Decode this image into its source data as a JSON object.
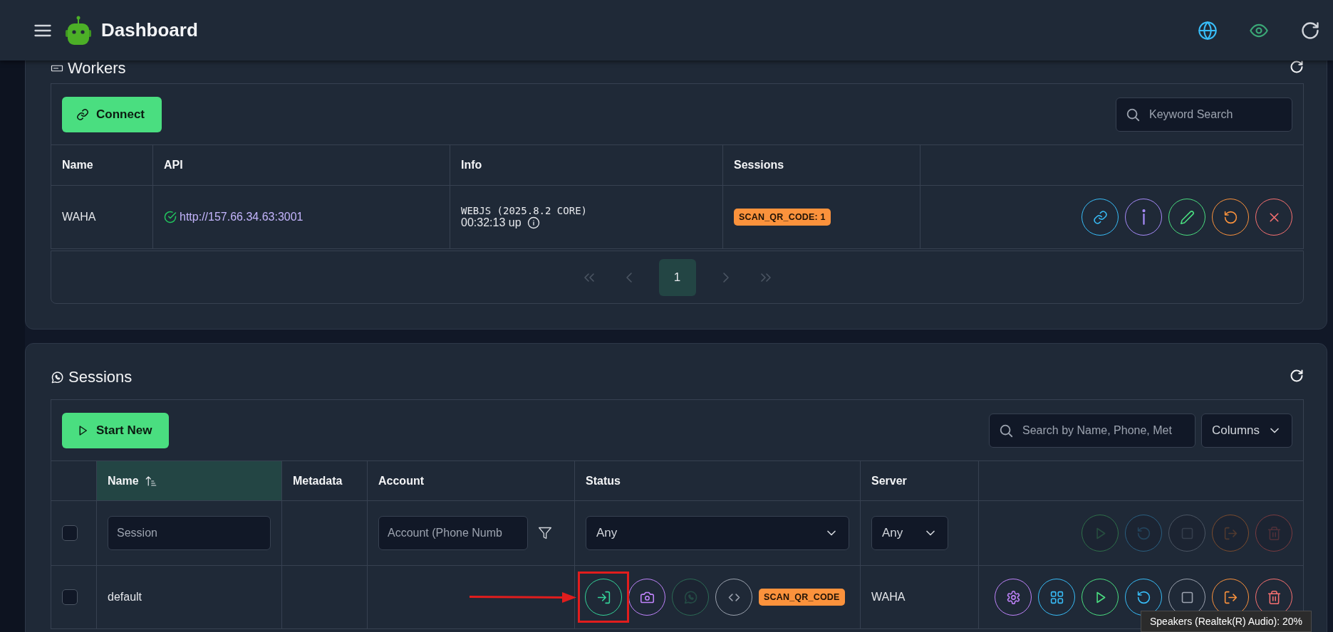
{
  "header": {
    "title": "Dashboard"
  },
  "workers": {
    "title": "Workers",
    "connect_button": "Connect",
    "search": {
      "placeholder": "Keyword Search"
    },
    "columns": [
      "Name",
      "API",
      "Info",
      "Sessions"
    ],
    "rows": [
      {
        "name": "WAHA",
        "api": "http://157.66.34.63:3001",
        "api_ok": true,
        "engine": "WEBJS (2025.8.2 CORE)",
        "uptime": "00:32:13 up",
        "sessions_badge": "SCAN_QR_CODE: 1",
        "actions": [
          {
            "kind": "link",
            "color": "#38bdf8"
          },
          {
            "kind": "info",
            "color": "#a78bfa"
          },
          {
            "kind": "edit",
            "color": "#4ade80"
          },
          {
            "kind": "restart",
            "color": "#fb923c"
          },
          {
            "kind": "remove",
            "color": "#f87171"
          }
        ]
      }
    ],
    "pages": [
      {
        "label": "1",
        "selected": true
      }
    ]
  },
  "sessions": {
    "title": "Sessions",
    "start_button": "Start New",
    "search": {
      "placeholder": "Search by Name, Phone, Met"
    },
    "columns_button": "Columns",
    "columns": [
      {
        "label": "Name",
        "sorted": true
      },
      {
        "label": "Metadata",
        "sorted": false
      },
      {
        "label": "Account",
        "sorted": false
      },
      {
        "label": "Status",
        "sorted": false
      },
      {
        "label": "Server",
        "sorted": false
      }
    ],
    "filters": {
      "checked": false,
      "name_placeholder": "Session",
      "account_placeholder": "Account (Phone Numb",
      "status": "Any",
      "server": "Any",
      "bulk_actions": [
        {
          "kind": "start",
          "color": "#2f6f4a",
          "disabled": true
        },
        {
          "kind": "restart",
          "color": "#2a5f80",
          "disabled": true
        },
        {
          "kind": "stop",
          "color": "#4b5563",
          "disabled": true
        },
        {
          "kind": "logout",
          "color": "#7a4b2e",
          "disabled": true
        },
        {
          "kind": "delete",
          "color": "#7a3b40",
          "disabled": true
        }
      ]
    },
    "rows": [
      {
        "checked": false,
        "name": "default",
        "status": "SCAN_QR_CODE",
        "server": "WAHA",
        "status_actions": [
          {
            "kind": "login",
            "color": "#34d399",
            "disabled": false,
            "highlighted": true
          },
          {
            "kind": "screenshot",
            "color": "#c084fc",
            "disabled": false,
            "highlighted": false
          },
          {
            "kind": "chat",
            "color": "#2c6b55",
            "disabled": true,
            "highlighted": false
          },
          {
            "kind": "code",
            "color": "#9ca3af",
            "disabled": false,
            "highlighted": false
          }
        ],
        "actions": [
          {
            "kind": "settings",
            "color": "#c084fc",
            "disabled": false
          },
          {
            "kind": "apps",
            "color": "#38bdf8",
            "disabled": false
          },
          {
            "kind": "start",
            "color": "#4ade80",
            "disabled": false
          },
          {
            "kind": "restart",
            "color": "#38bdf8",
            "disabled": false
          },
          {
            "kind": "stop",
            "color": "#9ca3af",
            "disabled": false
          },
          {
            "kind": "logout",
            "color": "#fb923c",
            "disabled": false
          },
          {
            "kind": "delete",
            "color": "#f87171",
            "disabled": false
          }
        ]
      }
    ]
  },
  "tooltip": "Speakers (Realtek(R) Audio): 20%"
}
